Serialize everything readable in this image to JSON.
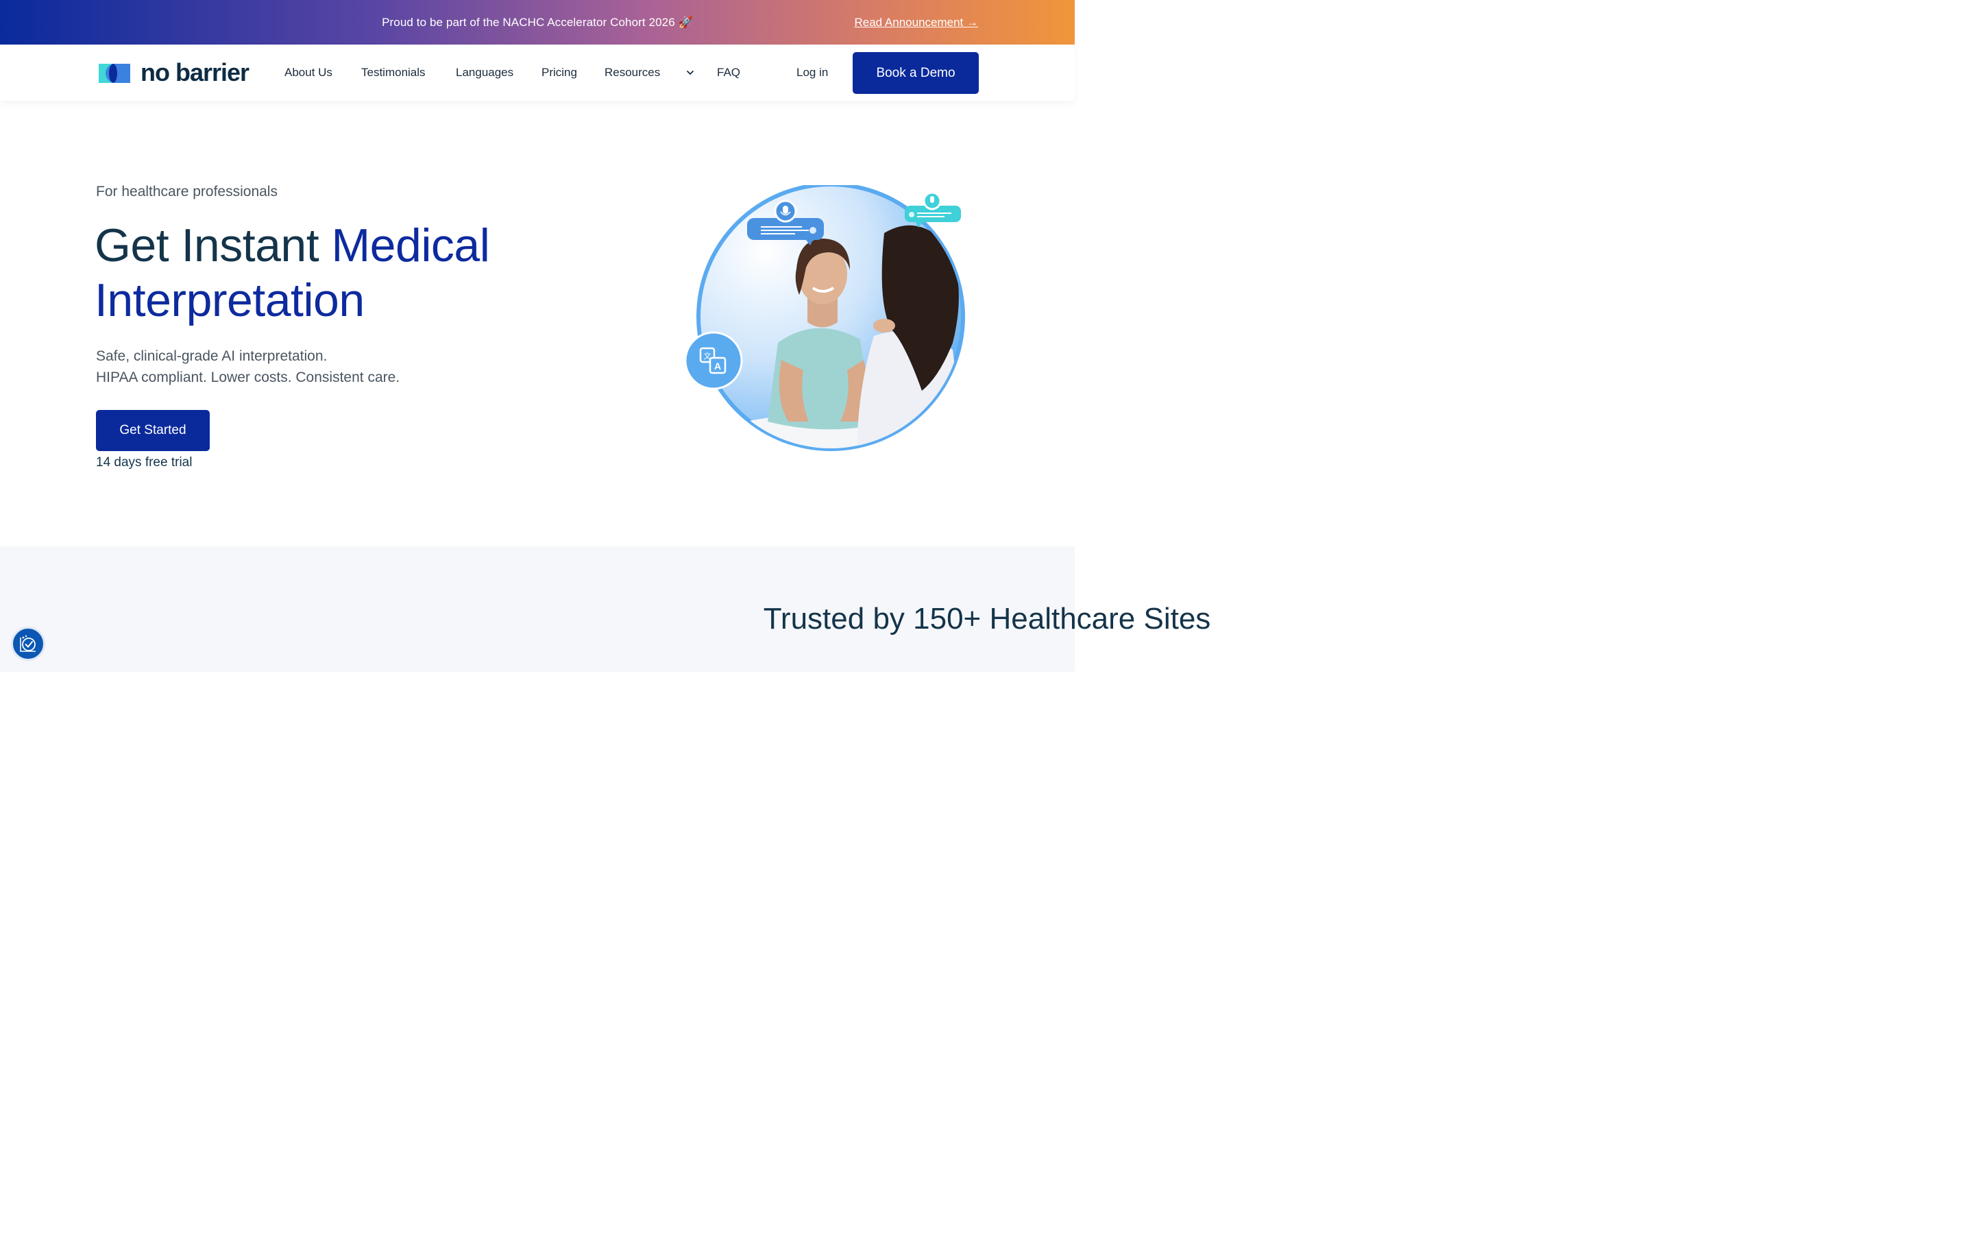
{
  "announcement": {
    "text": "Proud to be part of the NACHC Accelerator Cohort 2026 🚀",
    "link": "Read Announcement →"
  },
  "nav": {
    "logo_text": "no barrier",
    "items": [
      "About Us",
      "Testimonials",
      "Languages",
      "Pricing",
      "Resources",
      "FAQ"
    ],
    "login": "Log in",
    "demo": "Book a Demo"
  },
  "hero": {
    "eyebrow": "For healthcare professionals",
    "title_part1": "Get Instant ",
    "title_accent": "Medical Interpretation",
    "sub_line1": "Safe, clinical-grade AI interpretation.",
    "sub_line2": "HIPAA compliant. Lower costs. Consistent care.",
    "cta": "Get Started",
    "trial": "14 days free trial"
  },
  "trusted": {
    "title": "Trusted by 150+ Healthcare Sites"
  },
  "icons": {
    "translate": "translate-icon",
    "mic": "microphone-icon",
    "chevron": "chevron-down-icon",
    "accessibility": "accessibility-icon"
  },
  "colors": {
    "brand": "#0a2a9c",
    "heading": "#14344a",
    "accent_light": "#5aaaf0",
    "teal": "#3fd0d8"
  }
}
